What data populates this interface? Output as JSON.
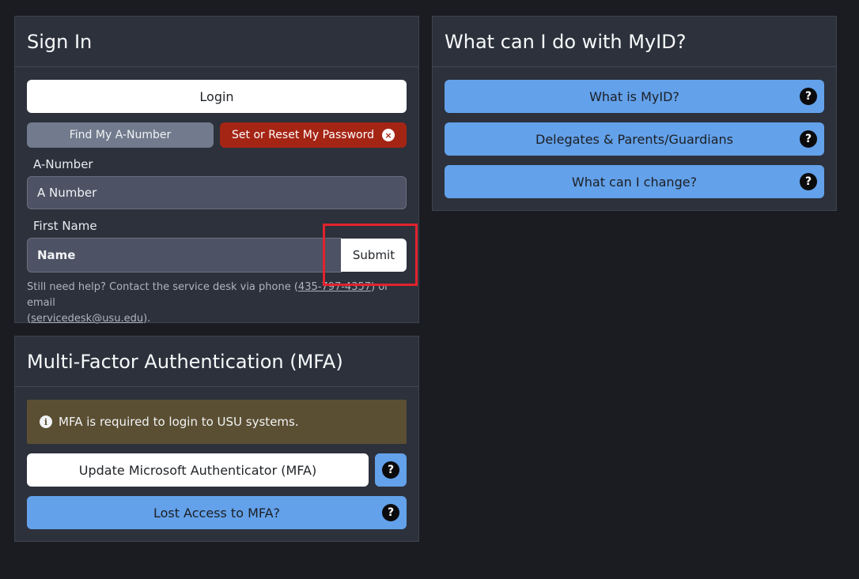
{
  "signin": {
    "title": "Sign In",
    "login_label": "Login",
    "find_anumber_label": "Find My A-Number",
    "reset_password_label": "Set or Reset My Password",
    "anumber_label": "A-Number",
    "anumber_placeholder": "A Number",
    "firstname_label": "First Name",
    "firstname_placeholder": "Name",
    "submit_label": "Submit",
    "help_prefix": "Still need help? Contact the service desk via phone (",
    "help_phone": "435-797-4357",
    "help_middle": ") or email",
    "help_open": "(",
    "help_email": "servicedesk@usu.edu",
    "help_suffix": ")."
  },
  "mfa": {
    "title": "Multi-Factor Authentication (MFA)",
    "alert_text": "MFA is required to login to USU systems.",
    "update_label": "Update Microsoft Authenticator (MFA)",
    "lost_label": "Lost Access to MFA?"
  },
  "myid": {
    "title": "What can I do with MyID?",
    "items": [
      {
        "label": "What is MyID?"
      },
      {
        "label": "Delegates & Parents/Guardians"
      },
      {
        "label": "What can I change?"
      }
    ]
  },
  "icons": {
    "question": "?",
    "close": "×",
    "info": "i"
  },
  "colors": {
    "accent_blue": "#63a1ea",
    "danger_red": "#a52515",
    "alert_bg": "#5b4f33",
    "highlight": "#e2232d"
  }
}
